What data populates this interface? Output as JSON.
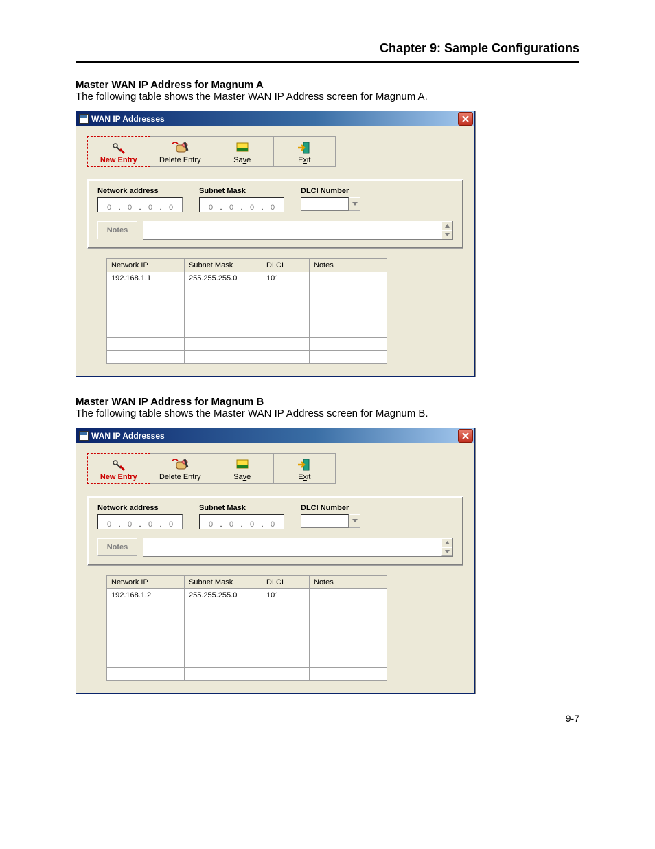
{
  "header": {
    "chapter_title": "Chapter 9: Sample Configurations"
  },
  "sections": [
    {
      "heading": "Master WAN IP Address for Magnum A",
      "desc": "The following table shows the Master WAN IP Address screen for Magnum A.",
      "network_ip": "192.168.1.1",
      "subnet_mask": "255.255.255.0",
      "dlci": "101",
      "notes": ""
    },
    {
      "heading": "Master WAN IP Address for Magnum B",
      "desc": "The following table shows the Master WAN IP Address screen for Magnum B.",
      "network_ip": "192.168.1.2",
      "subnet_mask": "255.255.255.0",
      "dlci": "101",
      "notes": ""
    }
  ],
  "window": {
    "title": "WAN IP Addresses",
    "toolbar": {
      "new_entry": "New Entry",
      "delete_entry": "Delete Entry",
      "save_pre": "Sa",
      "save_u": "v",
      "save_post": "e",
      "exit_pre": "E",
      "exit_u": "x",
      "exit_post": "it"
    },
    "labels": {
      "network_address": "Network address",
      "subnet_mask": "Subnet Mask",
      "dlci_number": "DLCI Number",
      "notes_btn": "Notes"
    },
    "ip_placeholder": "0",
    "table_headers": {
      "network_ip": "Network IP",
      "subnet_mask": "Subnet Mask",
      "dlci": "DLCI",
      "notes": "Notes"
    }
  },
  "footer": {
    "page_number": "9-7"
  }
}
